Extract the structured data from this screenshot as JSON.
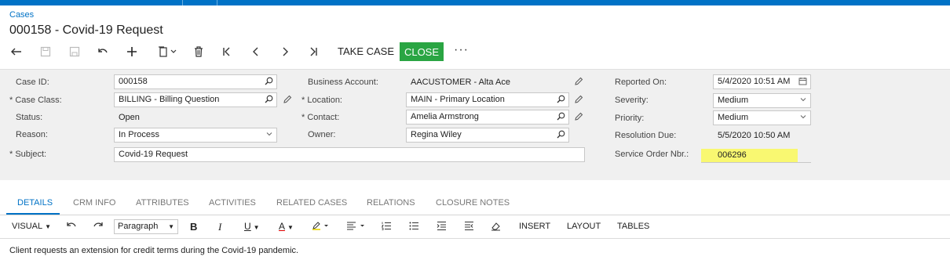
{
  "breadcrumb": "Cases",
  "title": "000158 - Covid-19 Request",
  "toolbar": {
    "take_case": "TAKE CASE",
    "close": "CLOSE",
    "more": "···"
  },
  "form": {
    "case_id": {
      "label": "Case ID:",
      "value": "000158"
    },
    "case_class": {
      "label": "Case Class:",
      "value": "BILLING - Billing Question"
    },
    "status": {
      "label": "Status:",
      "value": "Open"
    },
    "reason": {
      "label": "Reason:",
      "value": "In Process"
    },
    "subject": {
      "label": "Subject:",
      "value": "Covid-19 Request"
    },
    "business_account": {
      "label": "Business Account:",
      "value": "AACUSTOMER - Alta Ace"
    },
    "location": {
      "label": "Location:",
      "value": "MAIN - Primary Location"
    },
    "contact": {
      "label": "Contact:",
      "value": "Amelia Armstrong"
    },
    "owner": {
      "label": "Owner:",
      "value": "Regina Wiley"
    },
    "reported_on": {
      "label": "Reported On:",
      "value": "5/4/2020 10:51 AM"
    },
    "severity": {
      "label": "Severity:",
      "value": "Medium"
    },
    "priority": {
      "label": "Priority:",
      "value": "Medium"
    },
    "resolution_due": {
      "label": "Resolution Due:",
      "value": "5/5/2020 10:50 AM"
    },
    "service_order": {
      "label": "Service Order Nbr.:",
      "value": "006296"
    },
    "required_marker": "*"
  },
  "tabs": [
    "DETAILS",
    "CRM INFO",
    "ATTRIBUTES",
    "ACTIVITIES",
    "RELATED CASES",
    "RELATIONS",
    "CLOSURE NOTES"
  ],
  "editor": {
    "mode": "VISUAL",
    "paragraph": "Paragraph",
    "bold": "B",
    "italic": "I",
    "underline": "U",
    "font_color": "A",
    "insert": "INSERT",
    "layout": "LAYOUT",
    "tables": "TABLES",
    "content": "Client requests an extension for credit terms during the Covid-19 pandemic."
  },
  "colors": {
    "accent": "#0072c6",
    "close_button": "#2aa543",
    "highlight": "#f9f871"
  }
}
